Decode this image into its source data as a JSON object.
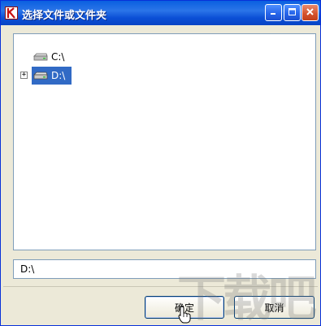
{
  "window": {
    "title": "选择文件或文件夹"
  },
  "tree": {
    "items": [
      {
        "label": "C:\\",
        "icon": "drive-icon",
        "selected": false,
        "expandable": false
      },
      {
        "label": "D:\\",
        "icon": "drive-icon",
        "selected": true,
        "expandable": true
      }
    ],
    "expander_symbol": "+"
  },
  "path_field": {
    "value": "D:\\"
  },
  "buttons": {
    "ok": "确定",
    "cancel": "取消"
  },
  "watermark": "下载吧",
  "colors": {
    "selection": "#316ac5",
    "titlebar": "#0a5fe0",
    "close_button": "#d4522c"
  }
}
